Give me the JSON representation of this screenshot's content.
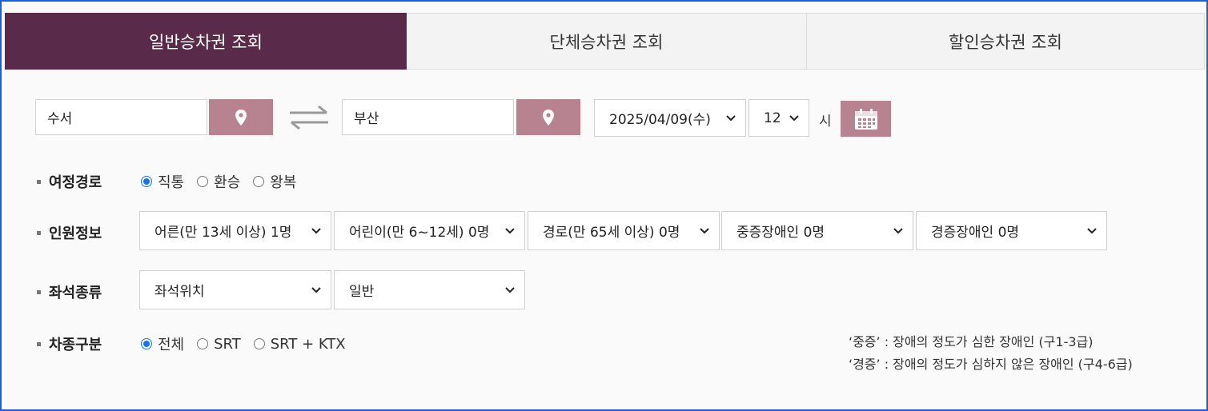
{
  "tabs": [
    {
      "label": "일반승차권 조회",
      "active": true
    },
    {
      "label": "단체승차권 조회",
      "active": false
    },
    {
      "label": "할인승차권 조회",
      "active": false
    }
  ],
  "search": {
    "departure": "수서",
    "arrival": "부산",
    "date": "2025/04/09(수)",
    "hour": "12",
    "hour_unit": "시"
  },
  "route": {
    "label": "여정경로",
    "options": [
      "직통",
      "환승",
      "왕복"
    ],
    "selected": "직통"
  },
  "passengers": {
    "label": "인원정보",
    "selects": [
      "어른(만 13세 이상) 1명",
      "어린이(만 6~12세) 0명",
      "경로(만 65세 이상) 0명",
      "중증장애인 0명",
      "경증장애인 0명"
    ]
  },
  "seat": {
    "label": "좌석종류",
    "position": "좌석위치",
    "class": "일반"
  },
  "train_type": {
    "label": "차종구분",
    "options": [
      "전체",
      "SRT",
      "SRT + KTX"
    ],
    "selected": "전체"
  },
  "notes": [
    "‘중증’ : 장애의 정도가 심한 장애인 (구1-3급)",
    "‘경증’ : 장애의 정도가 심하지 않은 장애인 (구4-6급)"
  ],
  "colors": {
    "active_tab": "#5a2a4a",
    "button": "#b78391",
    "radio": "#1a73e8",
    "frame_border": "#1f5fd6"
  },
  "icons": [
    "map-pin-icon",
    "swap-arrows-icon",
    "calendar-icon",
    "chevron-down-icon"
  ]
}
